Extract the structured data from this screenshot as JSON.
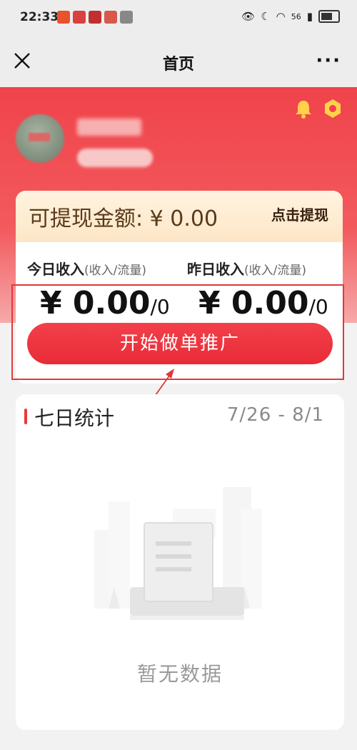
{
  "status_bar": {
    "time": "22:33",
    "icons_right": "56"
  },
  "nav": {
    "title": "首页",
    "more_label": "···"
  },
  "header": {
    "user_name": "昵称",
    "user_tag": "标签"
  },
  "withdraw": {
    "label": "可提现金额: ¥ 0.00",
    "button_label": "点击提现"
  },
  "income": {
    "today_label": "今日收入",
    "today_sub": "(收入/流量)",
    "today_amount": "¥ 0.00",
    "today_count": "/0",
    "yesterday_label": "昨日收入",
    "yesterday_sub": "(收入/流量)",
    "yesterday_amount": "¥ 0.00",
    "yesterday_count": "/0"
  },
  "promote_button": "开始做单推广",
  "stats": {
    "title": "七日统计",
    "range": "7/26 - 8/1",
    "empty_text": "暂无数据"
  },
  "colors": {
    "brand_red": "#f0434a",
    "annotation_red": "#e03a3a"
  },
  "icons": [
    "close-icon",
    "more-icon",
    "bell-icon",
    "gear-icon",
    "empty-data-icon"
  ]
}
